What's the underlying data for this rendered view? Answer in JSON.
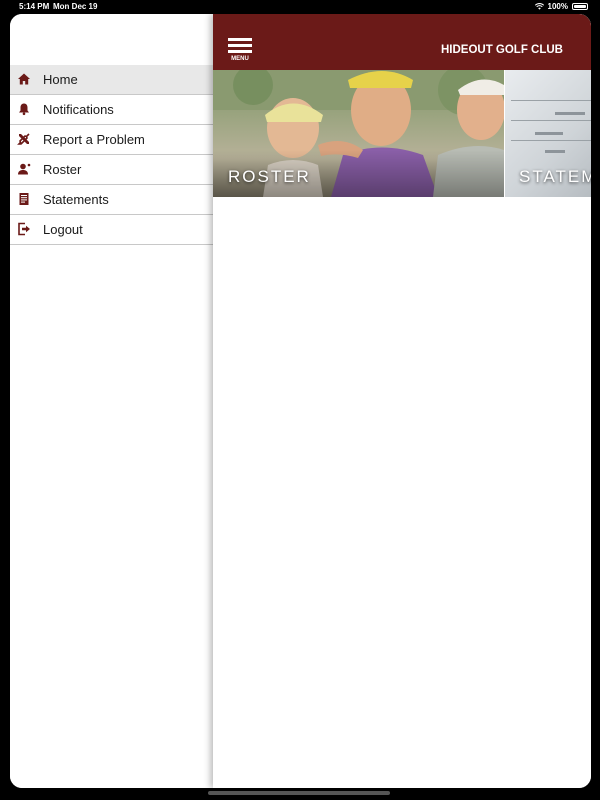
{
  "status": {
    "time": "5:14 PM",
    "date": "Mon Dec 19",
    "battery": "100%"
  },
  "app": {
    "club_name": "HIDEOUT GOLF CLUB",
    "menu_label": "MENU",
    "brand_color": "#6b1a18"
  },
  "menu": {
    "items": [
      {
        "label": "Home",
        "icon": "home-icon",
        "active": true
      },
      {
        "label": "Notifications",
        "icon": "bell-icon"
      },
      {
        "label": "Report a Problem",
        "icon": "tools-icon"
      },
      {
        "label": "Roster",
        "icon": "person-icon"
      },
      {
        "label": "Statements",
        "icon": "document-icon"
      },
      {
        "label": "Logout",
        "icon": "logout-icon"
      }
    ]
  },
  "tiles": [
    {
      "label": "ROSTER"
    },
    {
      "label": "STATEMENTS"
    }
  ]
}
